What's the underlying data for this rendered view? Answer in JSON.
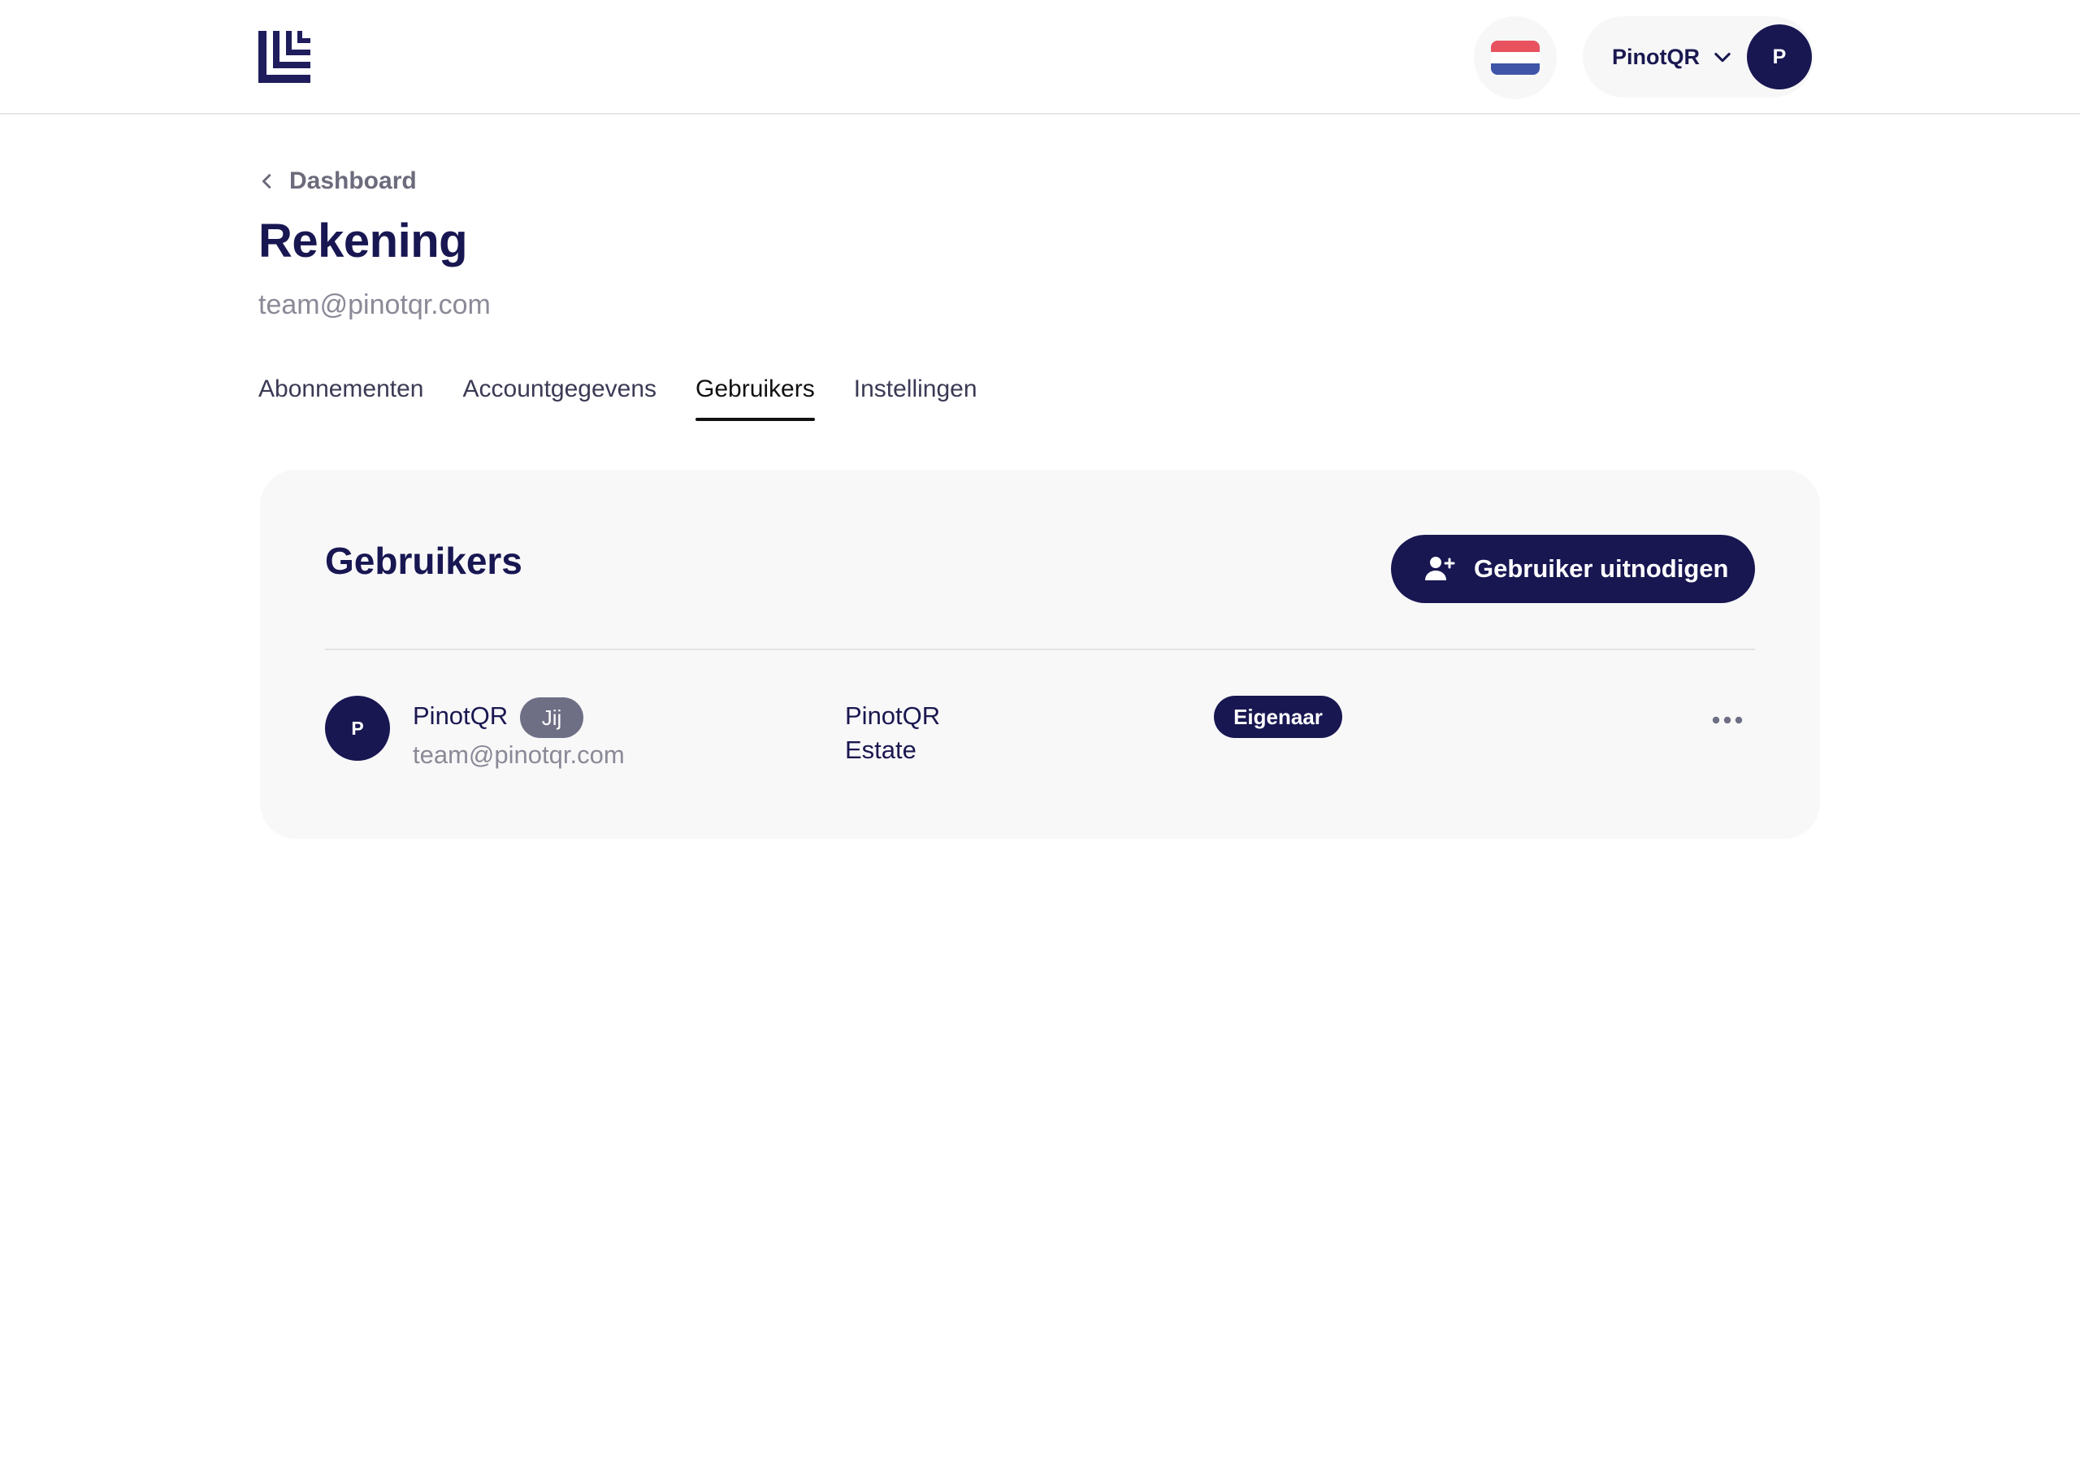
{
  "header": {
    "logo_icon": "brand-logo-icon",
    "language_flag_icon": "netherlands-flag-icon",
    "flag_colors": [
      "#e8525f",
      "#ffffff",
      "#3f55a8"
    ],
    "user_menu": {
      "name": "PinotQR",
      "chevron_icon": "chevron-down-icon",
      "avatar_initial": "P"
    }
  },
  "breadcrumb": {
    "icon": "chevron-left-icon",
    "label": "Dashboard"
  },
  "page": {
    "title": "Rekening",
    "subtitle": "team@pinotqr.com"
  },
  "tabs": [
    {
      "label": "Abonnementen",
      "active": false
    },
    {
      "label": "Accountgegevens",
      "active": false
    },
    {
      "label": "Gebruikers",
      "active": true
    },
    {
      "label": "Instellingen",
      "active": false
    }
  ],
  "users_section": {
    "title": "Gebruikers",
    "invite_button": {
      "label": "Gebruiker uitnodigen",
      "icon": "user-plus-icon"
    },
    "users": [
      {
        "avatar_initial": "P",
        "name": "PinotQR",
        "you_badge": "Jij",
        "email": "team@pinotqr.com",
        "company": "PinotQR Estate",
        "role": "Eigenaar",
        "actions_icon": "more-horizontal-icon"
      }
    ]
  },
  "colors": {
    "brand_navy": "#181752",
    "muted_text": "#8a8a97",
    "card_background": "#f8f8f9"
  }
}
